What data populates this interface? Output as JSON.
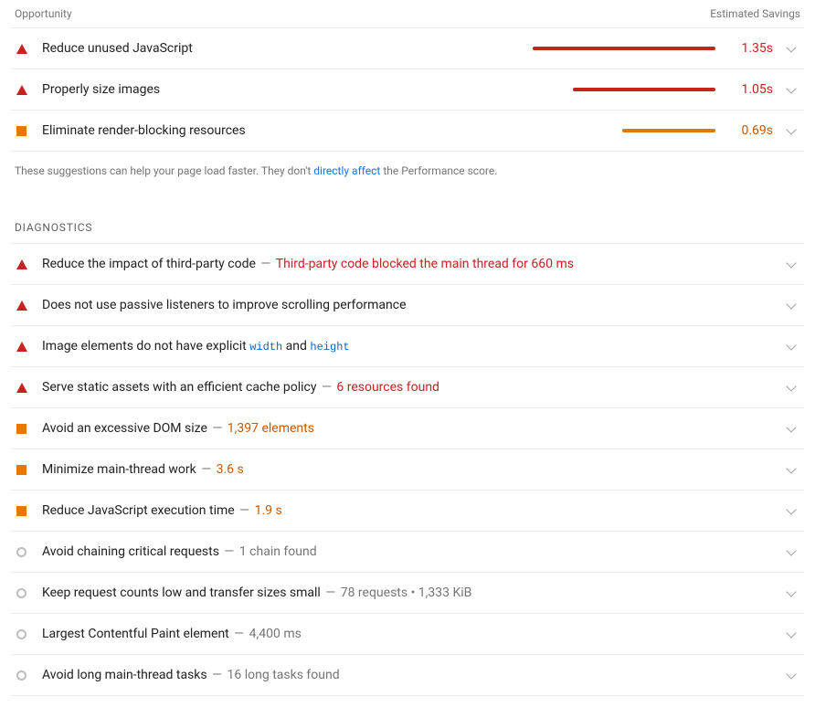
{
  "headers": {
    "opportunity": "Opportunity",
    "estimated_savings": "Estimated Savings"
  },
  "opportunities": [
    {
      "icon": "fail",
      "title": "Reduce unused JavaScript",
      "bar_pct": 100,
      "bar_color": "red",
      "savings": "1.35s",
      "savings_color": "red"
    },
    {
      "icon": "fail",
      "title": "Properly size images",
      "bar_pct": 78,
      "bar_color": "red",
      "savings": "1.05s",
      "savings_color": "red"
    },
    {
      "icon": "avg",
      "title": "Eliminate render-blocking resources",
      "bar_pct": 51,
      "bar_color": "orange",
      "savings": "0.69s",
      "savings_color": "orange"
    }
  ],
  "footnote": {
    "pre": "These suggestions can help your page load faster. They don't ",
    "link": "directly affect",
    "post": " the Performance score."
  },
  "diagnostics_title": "DIAGNOSTICS",
  "diagnostics": [
    {
      "icon": "fail",
      "title": "Reduce the impact of third-party code",
      "detail": "Third-party code blocked the main thread for 660 ms",
      "detail_color": "red"
    },
    {
      "icon": "fail",
      "title": "Does not use passive listeners to improve scrolling performance"
    },
    {
      "icon": "fail",
      "title_html": true,
      "title_pre": "Image elements do not have explicit ",
      "code1": "width",
      "mid": " and ",
      "code2": "height"
    },
    {
      "icon": "fail",
      "title": "Serve static assets with an efficient cache policy",
      "detail": "6 resources found",
      "detail_color": "red"
    },
    {
      "icon": "avg",
      "title": "Avoid an excessive DOM size",
      "detail": "1,397 elements",
      "detail_color": "orange"
    },
    {
      "icon": "avg",
      "title": "Minimize main-thread work",
      "detail": "3.6 s",
      "detail_color": "orange"
    },
    {
      "icon": "avg",
      "title": "Reduce JavaScript execution time",
      "detail": "1.9 s",
      "detail_color": "orange"
    },
    {
      "icon": "info",
      "title": "Avoid chaining critical requests",
      "detail": "1 chain found",
      "detail_color": "gray"
    },
    {
      "icon": "info",
      "title": "Keep request counts low and transfer sizes small",
      "detail": "78 requests • 1,333 KiB",
      "detail_color": "gray"
    },
    {
      "icon": "info",
      "title": "Largest Contentful Paint element",
      "detail": "4,400 ms",
      "detail_color": "gray"
    },
    {
      "icon": "info",
      "title": "Avoid long main-thread tasks",
      "detail": "16 long tasks found",
      "detail_color": "gray"
    }
  ]
}
